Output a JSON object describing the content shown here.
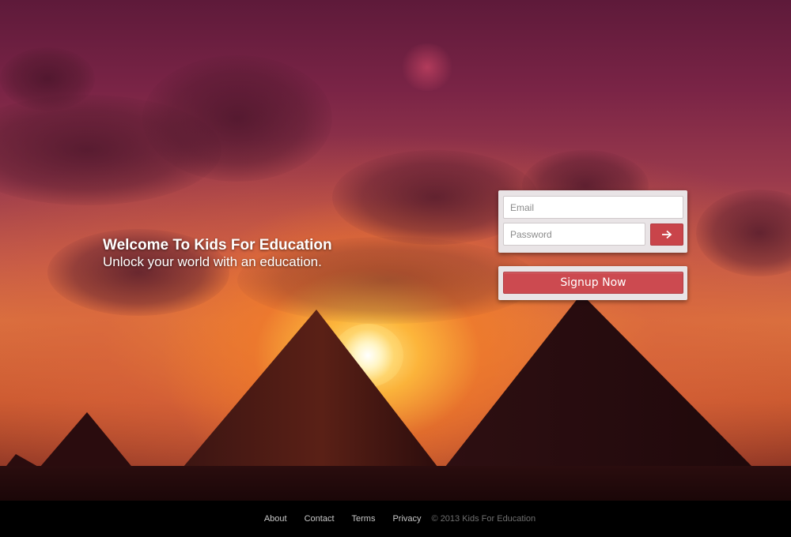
{
  "hero": {
    "title": "Welcome To Kids For Education",
    "subtitle": "Unlock your world with an education."
  },
  "login": {
    "email_placeholder": "Email",
    "password_placeholder": "Password",
    "submit_icon": "arrow-right-icon"
  },
  "signup": {
    "label": "Signup Now"
  },
  "footer": {
    "links": [
      "About",
      "Contact",
      "Terms",
      "Privacy"
    ],
    "copyright": "© 2013 Kids For Education"
  },
  "colors": {
    "accent": "#cc4a50",
    "panel": "#e9e4e6",
    "footer_bg": "#000000"
  }
}
